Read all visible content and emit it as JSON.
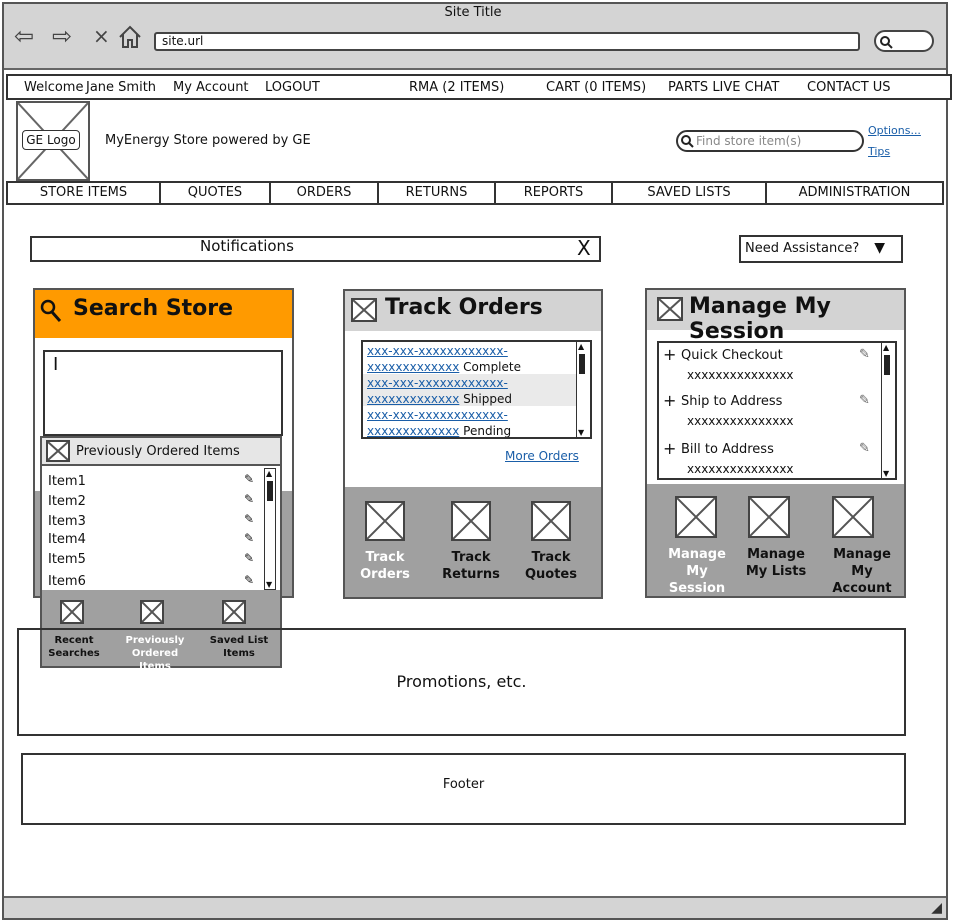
{
  "browser": {
    "title": "Site Title",
    "url": "site.url"
  },
  "topbar": {
    "welcome": "Welcome",
    "user": "Jane Smith",
    "my_account": "My Account",
    "logout": "LOGOUT",
    "rma": "RMA (2 ITEMS)",
    "cart": "CART (0 ITEMS)",
    "parts_chat": "PARTS LIVE CHAT",
    "contact": "CONTACT US"
  },
  "header": {
    "logo": "GE Logo",
    "store_name": "MyEnergy Store powered by GE",
    "search_placeholder": "Find store item(s)",
    "options": "Options...",
    "tips": "Tips"
  },
  "tabs": [
    "STORE ITEMS",
    "QUOTES",
    "ORDERS",
    "RETURNS",
    "REPORTS",
    "SAVED LISTS",
    "ADMINISTRATION"
  ],
  "notifications": {
    "title": "Notifications",
    "close": "X",
    "assistance": "Need Assistance?"
  },
  "search_store": {
    "title": "Search Store",
    "accent": "#ff9a00",
    "prev_title": "Previously Ordered Items",
    "items": [
      "Item1",
      "Item2",
      "Item3",
      "Item4",
      "Item5",
      "Item6"
    ],
    "footer": [
      "Recent Searches",
      "Previously Ordered Items",
      "Saved List Items"
    ]
  },
  "track_orders": {
    "title": "Track Orders",
    "orders": [
      {
        "line1": "xxx-xxx-xxxxxxxxxxxx-",
        "line2": "xxxxxxxxxxxxx",
        "status": "Complete"
      },
      {
        "line1": "xxx-xxx-xxxxxxxxxxxx-",
        "line2": "xxxxxxxxxxxxx",
        "status": "Shipped"
      },
      {
        "line1": "xxx-xxx-xxxxxxxxxxxx-",
        "line2": "xxxxxxxxxxxxx",
        "status": "Pending"
      }
    ],
    "more": "More Orders",
    "footer": [
      "Track Orders",
      "Track Returns",
      "Track Quotes"
    ]
  },
  "session": {
    "title": "Manage My Session",
    "items": [
      {
        "label": "Quick Checkout",
        "value": "xxxxxxxxxxxxxxx"
      },
      {
        "label": "Ship to Address",
        "value": "xxxxxxxxxxxxxxx"
      },
      {
        "label": "Bill to Address",
        "value": "xxxxxxxxxxxxxxx"
      }
    ],
    "footer": [
      "Manage My Session",
      "Manage My Lists",
      "Manage My Account"
    ]
  },
  "promo": "Promotions, etc.",
  "footer": "Footer"
}
